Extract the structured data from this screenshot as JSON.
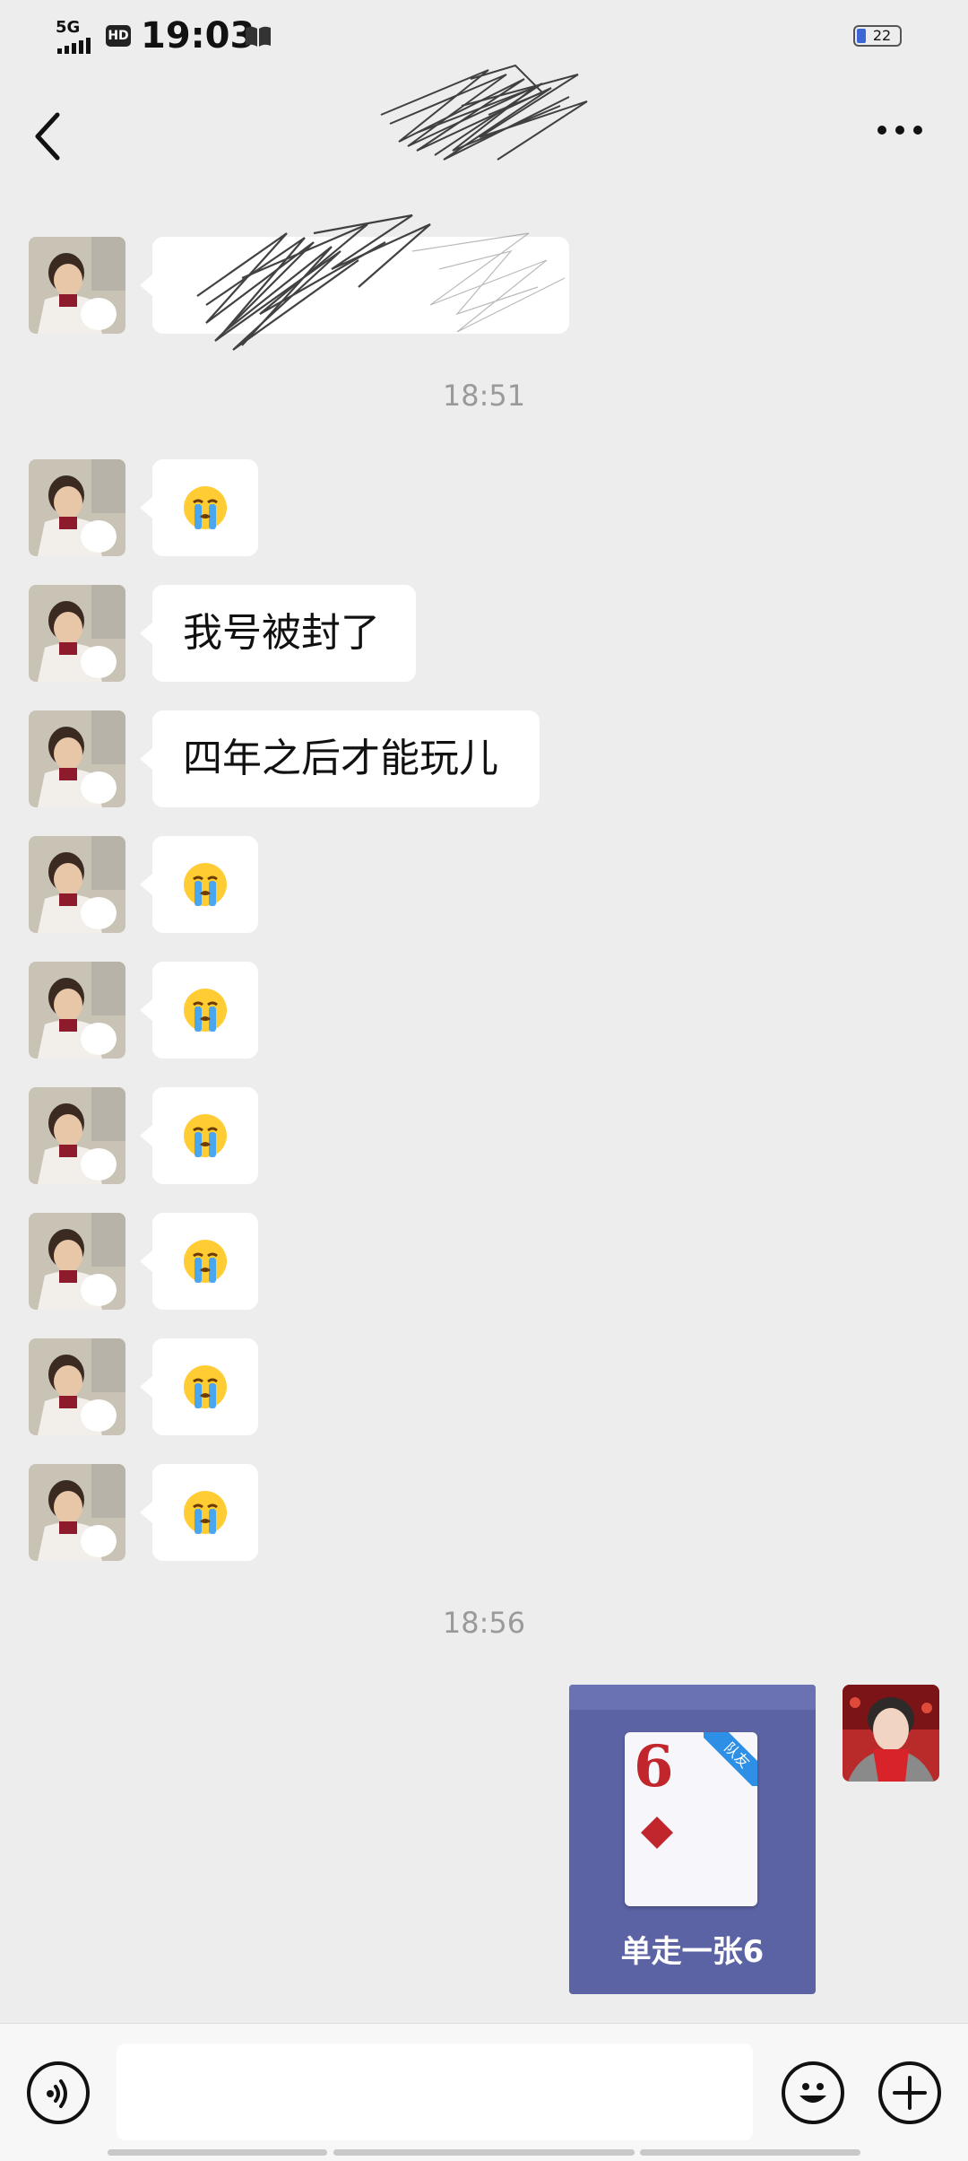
{
  "status_bar": {
    "network": "5G",
    "hd": "HD",
    "time": "19:03",
    "battery": "22"
  },
  "header": {
    "title": ""
  },
  "messages": {
    "redacted_preview": "",
    "ts1": "18:51",
    "m2": "我号被封了",
    "m3": "四年之后才能玩儿",
    "ts2": "18:56",
    "card": {
      "rank": "6",
      "tag": "队友",
      "caption": "单走一张6"
    }
  },
  "input": {
    "value": "",
    "placeholder": ""
  },
  "icons": {
    "voice": "voice-icon",
    "emoji": "emoji-icon",
    "more": "plus-icon",
    "back": "back-chevron-icon",
    "menu": "more-dots-icon"
  },
  "colors": {
    "background": "#ededed",
    "bubble": "#ffffff",
    "card_bg": "#5c63a4"
  }
}
